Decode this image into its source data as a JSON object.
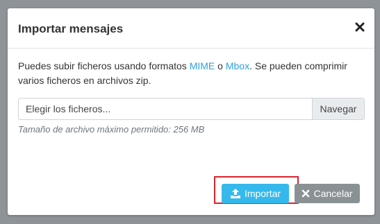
{
  "dialog": {
    "title": "Importar mensajes",
    "description": {
      "prefix": "Puedes subir ficheros usando formatos ",
      "mime_link": "MIME",
      "connector": " o ",
      "mbox_link": "Mbox",
      "suffix": ". Se pueden comprimir varios ficheros en archivos zip."
    },
    "file_input": {
      "placeholder": "Elegir los ficheros...",
      "browse_label": "Navegar"
    },
    "help_text": "Tamaño de archivo máximo permitido: 256 MB",
    "buttons": {
      "import_label": "Importar",
      "cancel_label": "Cancelar"
    }
  },
  "icons": {
    "close": "close-icon",
    "import": "upload-icon",
    "cancel": "x-icon"
  },
  "colors": {
    "link": "#2ea2dc",
    "import_button": "#35b9ec",
    "cancel_button": "#8a9195",
    "highlight": "#d9232e",
    "overlay": "#8e9398"
  }
}
